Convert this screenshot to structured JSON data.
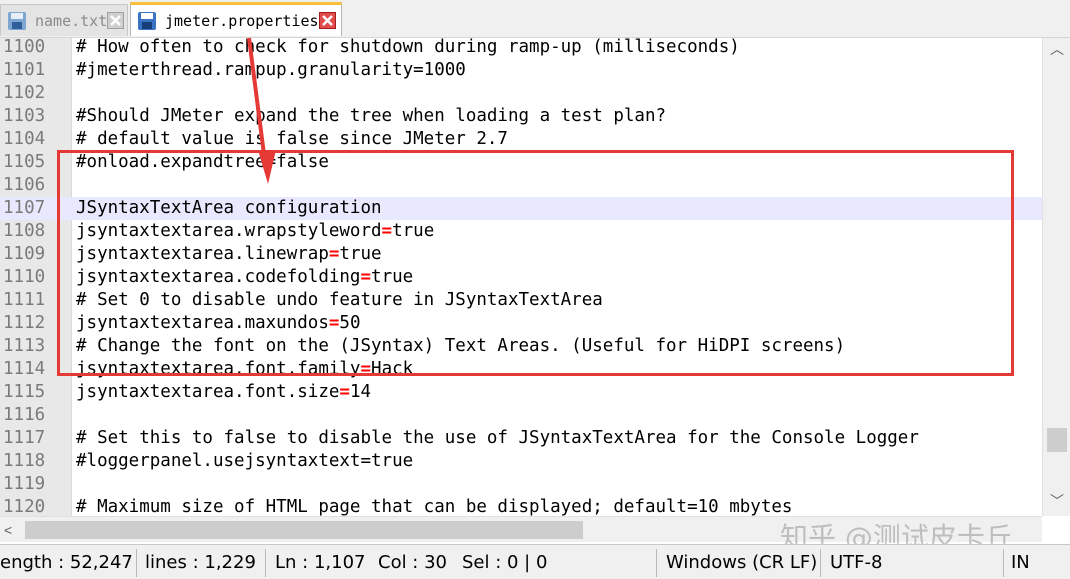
{
  "tabs": [
    {
      "label": "name.txt",
      "active": false
    },
    {
      "label": "jmeter.properties",
      "active": true
    }
  ],
  "editor": {
    "current_line": "1107",
    "lines": [
      {
        "num": "1100",
        "text": "# How often to check for shutdown during ramp-up (milliseconds)",
        "kind": "comment"
      },
      {
        "num": "1101",
        "text": "#jmeterthread.rampup.granularity=1000",
        "kind": "comment"
      },
      {
        "num": "1102",
        "text": "",
        "kind": "blank"
      },
      {
        "num": "1103",
        "text": "#Should JMeter expand the tree when loading a test plan?",
        "kind": "comment"
      },
      {
        "num": "1104",
        "text": "# default value is false since JMeter 2.7",
        "kind": "comment"
      },
      {
        "num": "1105",
        "text": "#onload.expandtree=false",
        "kind": "comment"
      },
      {
        "num": "1106",
        "text": "",
        "kind": "blank"
      },
      {
        "num": "1107",
        "text": "JSyntaxTextArea configuration",
        "kind": "plain"
      },
      {
        "num": "1108",
        "key": "jsyntaxtextarea.wrapstyleword",
        "value": "true",
        "kind": "property"
      },
      {
        "num": "1109",
        "key": "jsyntaxtextarea.linewrap",
        "value": "true",
        "kind": "property"
      },
      {
        "num": "1110",
        "key": "jsyntaxtextarea.codefolding",
        "value": "true",
        "kind": "property"
      },
      {
        "num": "1111",
        "text": "# Set 0 to disable undo feature in JSyntaxTextArea",
        "kind": "comment"
      },
      {
        "num": "1112",
        "key": "jsyntaxtextarea.maxundos",
        "value": "50",
        "kind": "property"
      },
      {
        "num": "1113",
        "text": "# Change the font on the (JSyntax) Text Areas. (Useful for HiDPI screens)",
        "kind": "comment"
      },
      {
        "num": "1114",
        "key": "jsyntaxtextarea.font.family",
        "value": "Hack",
        "kind": "property"
      },
      {
        "num": "1115",
        "key": "jsyntaxtextarea.font.size",
        "value": "14",
        "kind": "property"
      },
      {
        "num": "1116",
        "text": "",
        "kind": "blank"
      },
      {
        "num": "1117",
        "text": "# Set this to false to disable the use of JSyntaxTextArea for the Console Logger",
        "kind": "comment"
      },
      {
        "num": "1118",
        "text": "#loggerpanel.usejsyntaxtext=true",
        "kind": "comment"
      },
      {
        "num": "1119",
        "text": "",
        "kind": "blank"
      },
      {
        "num": "1120",
        "text": "# Maximum size of HTML page that can be displayed; default=10 mbytes",
        "kind": "comment"
      }
    ]
  },
  "watermark": "知乎 @测试皮卡丘",
  "status": {
    "length": "ength : 52,247",
    "lines": "lines : 1,229",
    "ln": "Ln : 1,107",
    "col": "Col : 30",
    "sel": "Sel : 0 | 0",
    "eol": "Windows (CR LF)",
    "encoding": "UTF-8",
    "mode": "IN"
  },
  "colors": {
    "comment": "#008000",
    "operator": "#ff0000",
    "current_line_bg": "#e8e8ff",
    "annotation_red": "#e53935",
    "active_tab_accent": "#fcbf3c"
  },
  "icons": {
    "tab_save": "floppy-disk-icon",
    "tab_close": "close-x-icon",
    "scroll_up": "up-arrow-icon",
    "scroll_down": "down-arrow-icon",
    "scroll_left": "left-arrow-icon"
  }
}
